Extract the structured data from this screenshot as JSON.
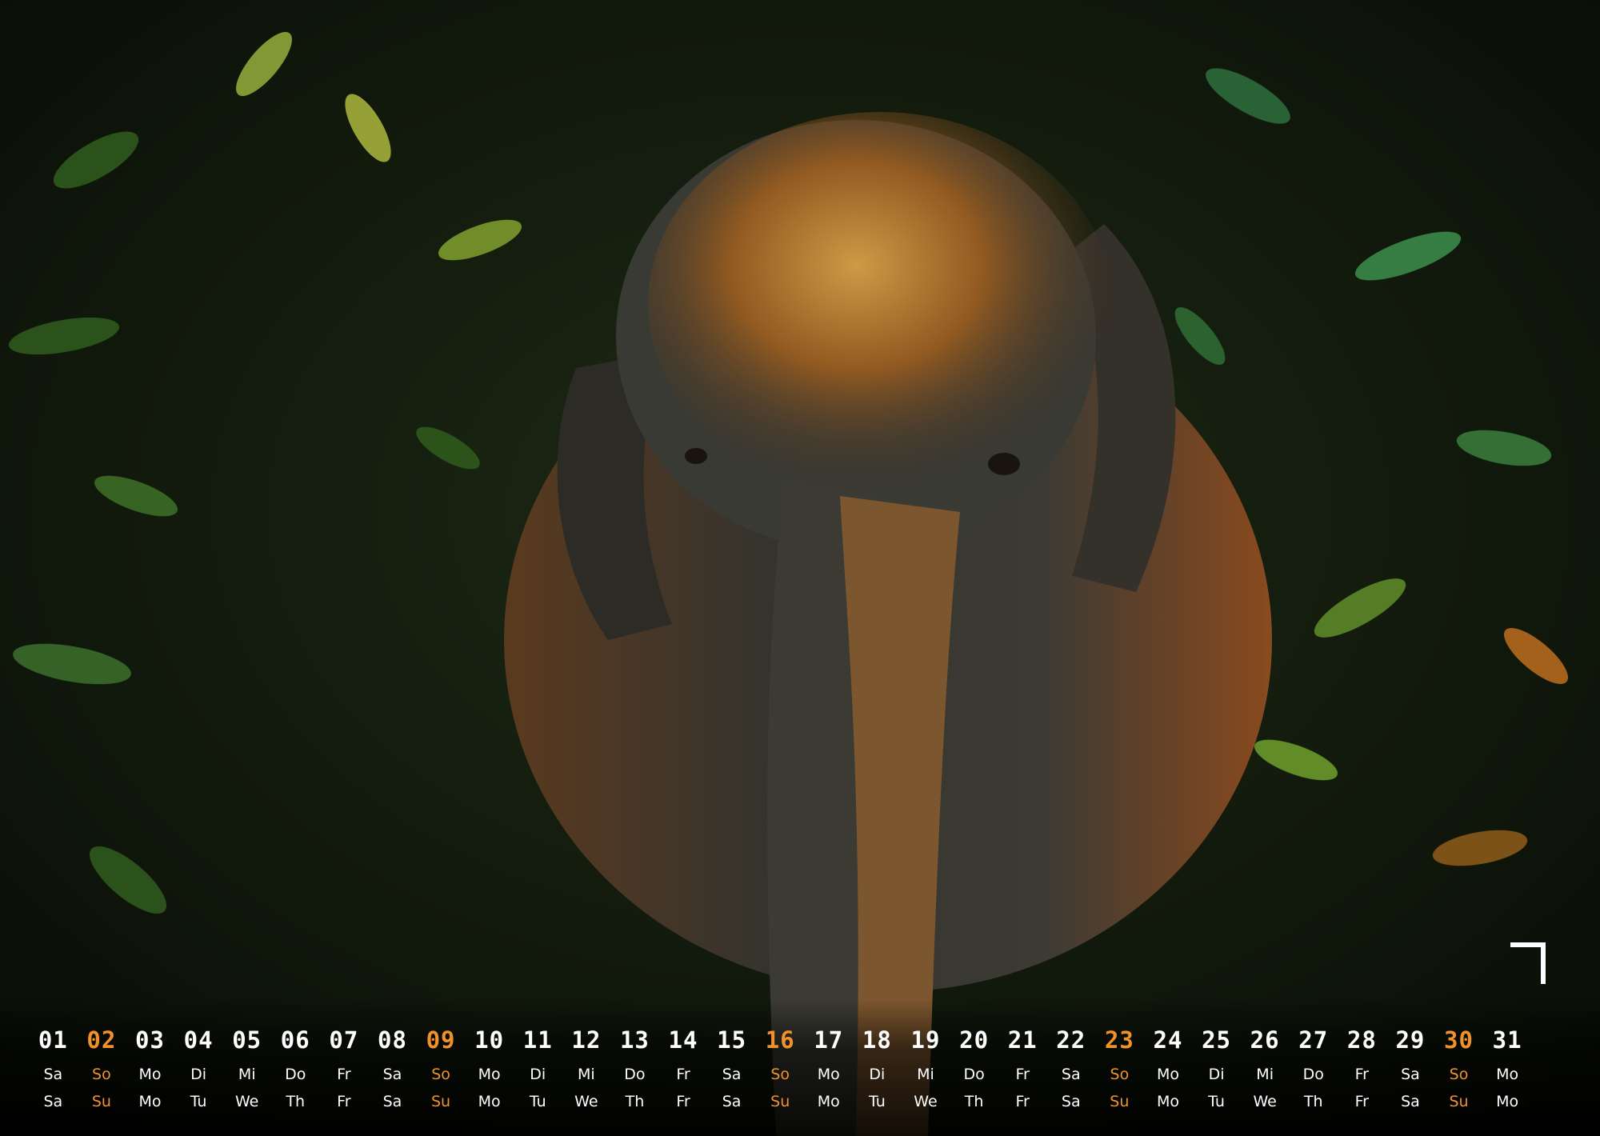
{
  "colors": {
    "background": "#0a0d08",
    "text": "#ffffff",
    "sunday": "#f0922a",
    "foliage": "#2f5a1c",
    "elephant_skin": "#3a3a34",
    "highlight": "#e8a23a"
  },
  "month_mark_icon": "month-corner-7-glyph",
  "calendar": {
    "days": [
      {
        "num": "01",
        "de": "Sa",
        "en": "Sa",
        "sunday": false
      },
      {
        "num": "02",
        "de": "So",
        "en": "Su",
        "sunday": true
      },
      {
        "num": "03",
        "de": "Mo",
        "en": "Mo",
        "sunday": false
      },
      {
        "num": "04",
        "de": "Di",
        "en": "Tu",
        "sunday": false
      },
      {
        "num": "05",
        "de": "Mi",
        "en": "We",
        "sunday": false
      },
      {
        "num": "06",
        "de": "Do",
        "en": "Th",
        "sunday": false
      },
      {
        "num": "07",
        "de": "Fr",
        "en": "Fr",
        "sunday": false
      },
      {
        "num": "08",
        "de": "Sa",
        "en": "Sa",
        "sunday": false
      },
      {
        "num": "09",
        "de": "So",
        "en": "Su",
        "sunday": true
      },
      {
        "num": "10",
        "de": "Mo",
        "en": "Mo",
        "sunday": false
      },
      {
        "num": "11",
        "de": "Di",
        "en": "Tu",
        "sunday": false
      },
      {
        "num": "12",
        "de": "Mi",
        "en": "We",
        "sunday": false
      },
      {
        "num": "13",
        "de": "Do",
        "en": "Th",
        "sunday": false
      },
      {
        "num": "14",
        "de": "Fr",
        "en": "Fr",
        "sunday": false
      },
      {
        "num": "15",
        "de": "Sa",
        "en": "Sa",
        "sunday": false
      },
      {
        "num": "16",
        "de": "So",
        "en": "Su",
        "sunday": true
      },
      {
        "num": "17",
        "de": "Mo",
        "en": "Mo",
        "sunday": false
      },
      {
        "num": "18",
        "de": "Di",
        "en": "Tu",
        "sunday": false
      },
      {
        "num": "19",
        "de": "Mi",
        "en": "We",
        "sunday": false
      },
      {
        "num": "20",
        "de": "Do",
        "en": "Th",
        "sunday": false
      },
      {
        "num": "21",
        "de": "Fr",
        "en": "Fr",
        "sunday": false
      },
      {
        "num": "22",
        "de": "Sa",
        "en": "Sa",
        "sunday": false
      },
      {
        "num": "23",
        "de": "So",
        "en": "Su",
        "sunday": true
      },
      {
        "num": "24",
        "de": "Mo",
        "en": "Mo",
        "sunday": false
      },
      {
        "num": "25",
        "de": "Di",
        "en": "Tu",
        "sunday": false
      },
      {
        "num": "26",
        "de": "Mi",
        "en": "We",
        "sunday": false
      },
      {
        "num": "27",
        "de": "Do",
        "en": "Th",
        "sunday": false
      },
      {
        "num": "28",
        "de": "Fr",
        "en": "Fr",
        "sunday": false
      },
      {
        "num": "29",
        "de": "Sa",
        "en": "Sa",
        "sunday": false
      },
      {
        "num": "30",
        "de": "So",
        "en": "Su",
        "sunday": true
      },
      {
        "num": "31",
        "de": "Mo",
        "en": "Mo",
        "sunday": false
      }
    ]
  }
}
